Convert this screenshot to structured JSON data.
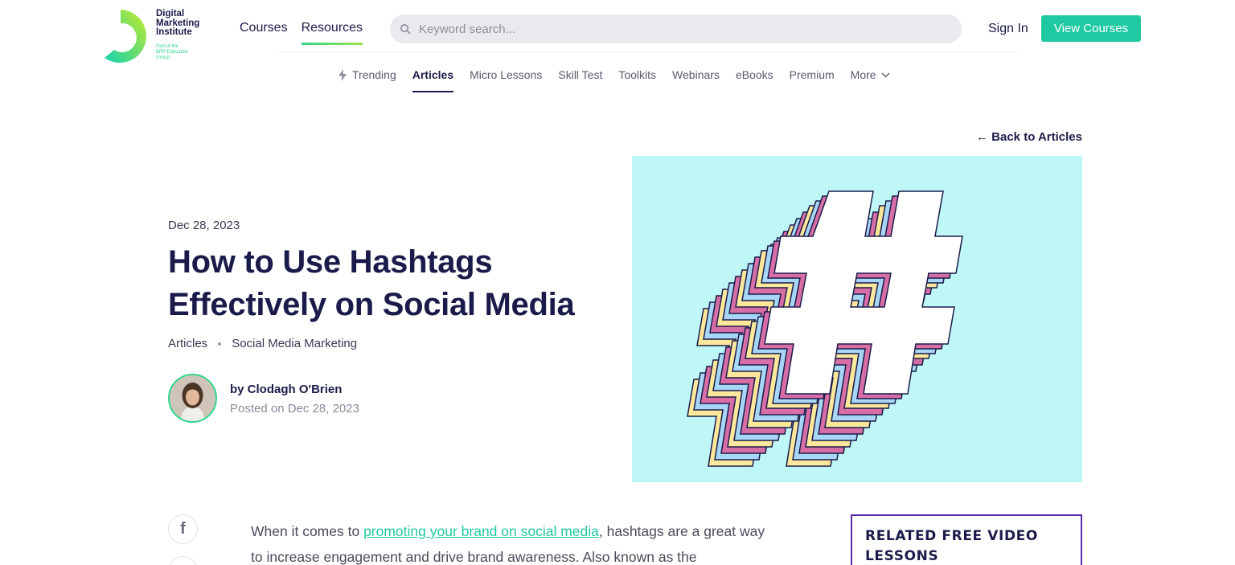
{
  "brand": {
    "name_lines": [
      "Digital",
      "Marketing",
      "Institute"
    ],
    "sub_lines": [
      "Part of the",
      "BPP Education",
      "Group"
    ],
    "accent": "#2fd68a",
    "cta_color": "#1fc9a2"
  },
  "topnav": {
    "items": [
      "Courses",
      "Resources"
    ],
    "active": "Resources"
  },
  "search": {
    "placeholder": "Keyword search..."
  },
  "header_actions": {
    "signin": "Sign In",
    "view_courses": "View Courses"
  },
  "subnav": {
    "items": [
      "Trending",
      "Articles",
      "Micro Lessons",
      "Skill Test",
      "Toolkits",
      "Webinars",
      "eBooks",
      "Premium",
      "More"
    ],
    "active": "Articles"
  },
  "article": {
    "back_link": "← Back to Articles",
    "date": "Dec 28, 2023",
    "title": "How to Use Hashtags Effectively on Social Media",
    "categories": [
      "Articles",
      "Social Media Marketing"
    ],
    "author": "by Clodagh O'Brien",
    "posted": "Posted on Dec 28, 2023",
    "intro_before": "When it comes to ",
    "intro_link": "promoting your brand on social media",
    "intro_after": ", hashtags are a great way to increase engagement and drive brand awareness. Also known as the"
  },
  "share": {
    "facebook_glyph": "f"
  },
  "sidebar": {
    "related_title": "RELATED FREE VIDEO LESSONS"
  }
}
